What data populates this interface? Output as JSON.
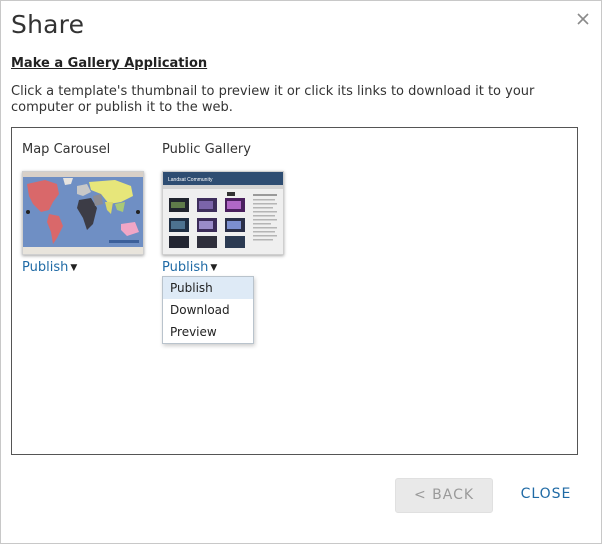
{
  "dialog": {
    "title": "Share",
    "section_heading": "Make a Gallery Application",
    "intro": "Click a template's thumbnail to preview it or click its links to download it to your computer or publish it to the web."
  },
  "templates": [
    {
      "name": "Map Carousel",
      "link_label": "Publish",
      "thumbnail_icon": "world-map-thumbnail"
    },
    {
      "name": "Public Gallery",
      "link_label": "Publish",
      "thumbnail_icon": "gallery-page-thumbnail",
      "thumbnail_header": "Landsat Community"
    }
  ],
  "dropdown": {
    "items": [
      "Publish",
      "Download",
      "Preview"
    ],
    "highlighted": "Publish"
  },
  "footer": {
    "back_label": "< BACK",
    "close_label": "CLOSE"
  },
  "colors": {
    "link": "#1f6aa5",
    "menu_highlight": "#deeaf6",
    "back_button_bg": "#e9e9e9"
  }
}
